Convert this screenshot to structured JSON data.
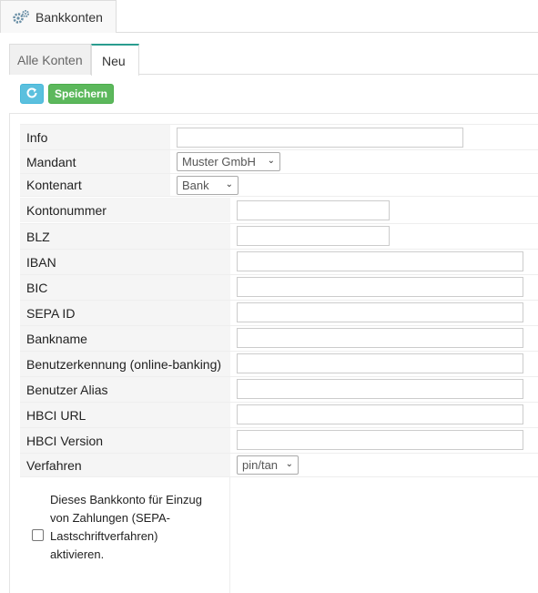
{
  "window": {
    "tab_title": "Bankkonten",
    "tab_icon": "gears-icon"
  },
  "tabs": [
    {
      "label": "Alle Konten",
      "active": false
    },
    {
      "label": "Neu",
      "active": true
    }
  ],
  "toolbar": {
    "refresh_icon": "refresh-icon",
    "save_label": "Speichern"
  },
  "form": {
    "info": {
      "label": "Info",
      "value": ""
    },
    "mandant": {
      "label": "Mandant",
      "value": "Muster GmbH"
    },
    "kontenart": {
      "label": "Kontenart",
      "value": "Bank"
    },
    "kontonummer": {
      "label": "Kontonummer",
      "value": ""
    },
    "blz": {
      "label": "BLZ",
      "value": ""
    },
    "iban": {
      "label": "IBAN",
      "value": ""
    },
    "bic": {
      "label": "BIC",
      "value": ""
    },
    "sepa_id": {
      "label": "SEPA ID",
      "value": ""
    },
    "bankname": {
      "label": "Bankname",
      "value": ""
    },
    "benutzerkennung": {
      "label": "Benutzerkennung (online-banking)",
      "value": ""
    },
    "benutzer_alias": {
      "label": "Benutzer Alias",
      "value": ""
    },
    "hbci_url": {
      "label": "HBCI URL",
      "value": ""
    },
    "hbci_version": {
      "label": "HBCI Version",
      "value": ""
    },
    "verfahren": {
      "label": "Verfahren",
      "value": "pin/tan"
    },
    "lastschrift_checkbox": {
      "label": "Dieses Bankkonto für Einzug von Zahlungen (SEPA-Lastschriftverfahren) aktivieren.",
      "checked": false
    }
  },
  "colors": {
    "accent": "#2a9d8f",
    "save": "#5cb85c",
    "refresh": "#5bc0de"
  }
}
